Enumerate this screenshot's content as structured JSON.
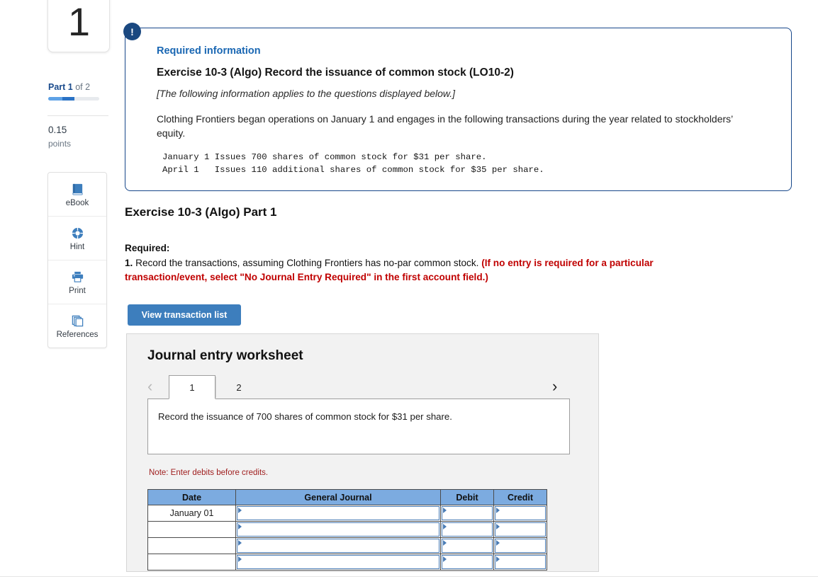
{
  "sidebar": {
    "question_number": "1",
    "part_strong": "Part 1",
    "part_rest": " of 2",
    "points_value": "0.15",
    "points_label": "points",
    "tools": [
      {
        "label": "eBook",
        "icon": "book-icon"
      },
      {
        "label": "Hint",
        "icon": "life-ring-icon"
      },
      {
        "label": "Print",
        "icon": "printer-icon"
      },
      {
        "label": "References",
        "icon": "copy-pages-icon"
      }
    ]
  },
  "required_info": {
    "badge": "!",
    "heading": "Required information",
    "exercise_title": "Exercise 10-3 (Algo) Record the issuance of common stock (LO10-2)",
    "applies_note": "[The following information applies to the questions displayed below.]",
    "paragraph": "Clothing Frontiers began operations on January 1 and engages in the following transactions during the year related to stockholders’ equity.",
    "transactions_monospace": "January 1 Issues 700 shares of common stock for $31 per share.\nApril 1   Issues 110 additional shares of common stock for $35 per share."
  },
  "part_section": {
    "heading": "Exercise 10-3 (Algo) Part 1",
    "required_label": "Required:",
    "requirement_number": "1.",
    "requirement_text": " Record the transactions, assuming Clothing Frontiers has no-par common stock. ",
    "requirement_red": "(If no entry is required for a particular transaction/event, select \"No Journal Entry Required\" in the first account field.)",
    "view_transaction_button": "View transaction list"
  },
  "worksheet": {
    "title": "Journal entry worksheet",
    "prev_chevron": "‹",
    "next_chevron": "›",
    "tabs": [
      {
        "label": "1",
        "active": true
      },
      {
        "label": "2",
        "active": false
      }
    ],
    "instruction": "Record the issuance of 700 shares of common stock for $31 per share.",
    "note": "Note: Enter debits before credits.",
    "table": {
      "headers": [
        "Date",
        "General Journal",
        "Debit",
        "Credit"
      ],
      "rows": [
        {
          "date": "January 01",
          "general_journal": "",
          "debit": "",
          "credit": ""
        },
        {
          "date": "",
          "general_journal": "",
          "debit": "",
          "credit": ""
        },
        {
          "date": "",
          "general_journal": "",
          "debit": "",
          "credit": ""
        },
        {
          "date": "",
          "general_journal": "",
          "debit": "",
          "credit": ""
        }
      ]
    }
  },
  "colors": {
    "accent_blue": "#3d7ebd",
    "navy": "#1a4880",
    "table_header_blue": "#7cabe0",
    "red": "#c00000",
    "panel_gray": "#f2f2f2"
  }
}
